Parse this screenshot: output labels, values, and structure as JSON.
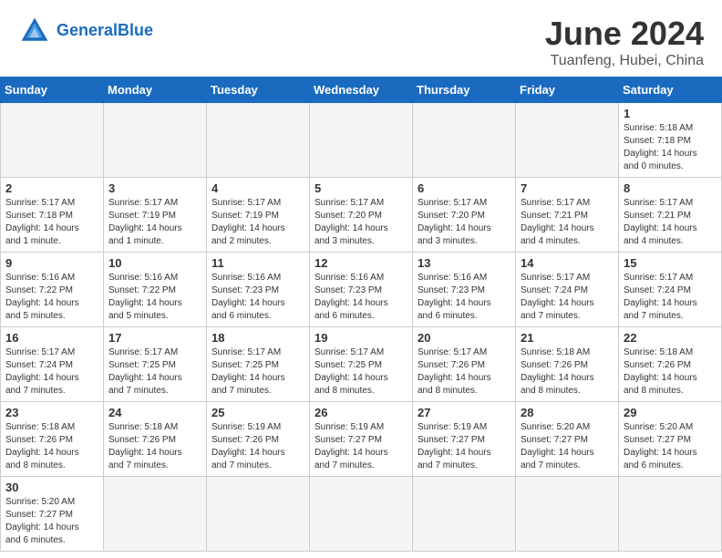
{
  "header": {
    "logo_general": "General",
    "logo_blue": "Blue",
    "title": "June 2024",
    "subtitle": "Tuanfeng, Hubei, China"
  },
  "weekdays": [
    "Sunday",
    "Monday",
    "Tuesday",
    "Wednesday",
    "Thursday",
    "Friday",
    "Saturday"
  ],
  "weeks": [
    [
      {
        "day": "",
        "info": ""
      },
      {
        "day": "",
        "info": ""
      },
      {
        "day": "",
        "info": ""
      },
      {
        "day": "",
        "info": ""
      },
      {
        "day": "",
        "info": ""
      },
      {
        "day": "",
        "info": ""
      },
      {
        "day": "1",
        "info": "Sunrise: 5:18 AM\nSunset: 7:18 PM\nDaylight: 14 hours\nand 0 minutes."
      }
    ],
    [
      {
        "day": "2",
        "info": "Sunrise: 5:17 AM\nSunset: 7:18 PM\nDaylight: 14 hours\nand 1 minute."
      },
      {
        "day": "3",
        "info": "Sunrise: 5:17 AM\nSunset: 7:19 PM\nDaylight: 14 hours\nand 1 minute."
      },
      {
        "day": "4",
        "info": "Sunrise: 5:17 AM\nSunset: 7:19 PM\nDaylight: 14 hours\nand 2 minutes."
      },
      {
        "day": "5",
        "info": "Sunrise: 5:17 AM\nSunset: 7:20 PM\nDaylight: 14 hours\nand 3 minutes."
      },
      {
        "day": "6",
        "info": "Sunrise: 5:17 AM\nSunset: 7:20 PM\nDaylight: 14 hours\nand 3 minutes."
      },
      {
        "day": "7",
        "info": "Sunrise: 5:17 AM\nSunset: 7:21 PM\nDaylight: 14 hours\nand 4 minutes."
      },
      {
        "day": "8",
        "info": "Sunrise: 5:17 AM\nSunset: 7:21 PM\nDaylight: 14 hours\nand 4 minutes."
      }
    ],
    [
      {
        "day": "9",
        "info": "Sunrise: 5:16 AM\nSunset: 7:22 PM\nDaylight: 14 hours\nand 5 minutes."
      },
      {
        "day": "10",
        "info": "Sunrise: 5:16 AM\nSunset: 7:22 PM\nDaylight: 14 hours\nand 5 minutes."
      },
      {
        "day": "11",
        "info": "Sunrise: 5:16 AM\nSunset: 7:23 PM\nDaylight: 14 hours\nand 6 minutes."
      },
      {
        "day": "12",
        "info": "Sunrise: 5:16 AM\nSunset: 7:23 PM\nDaylight: 14 hours\nand 6 minutes."
      },
      {
        "day": "13",
        "info": "Sunrise: 5:16 AM\nSunset: 7:23 PM\nDaylight: 14 hours\nand 6 minutes."
      },
      {
        "day": "14",
        "info": "Sunrise: 5:17 AM\nSunset: 7:24 PM\nDaylight: 14 hours\nand 7 minutes."
      },
      {
        "day": "15",
        "info": "Sunrise: 5:17 AM\nSunset: 7:24 PM\nDaylight: 14 hours\nand 7 minutes."
      }
    ],
    [
      {
        "day": "16",
        "info": "Sunrise: 5:17 AM\nSunset: 7:24 PM\nDaylight: 14 hours\nand 7 minutes."
      },
      {
        "day": "17",
        "info": "Sunrise: 5:17 AM\nSunset: 7:25 PM\nDaylight: 14 hours\nand 7 minutes."
      },
      {
        "day": "18",
        "info": "Sunrise: 5:17 AM\nSunset: 7:25 PM\nDaylight: 14 hours\nand 7 minutes."
      },
      {
        "day": "19",
        "info": "Sunrise: 5:17 AM\nSunset: 7:25 PM\nDaylight: 14 hours\nand 8 minutes."
      },
      {
        "day": "20",
        "info": "Sunrise: 5:17 AM\nSunset: 7:26 PM\nDaylight: 14 hours\nand 8 minutes."
      },
      {
        "day": "21",
        "info": "Sunrise: 5:18 AM\nSunset: 7:26 PM\nDaylight: 14 hours\nand 8 minutes."
      },
      {
        "day": "22",
        "info": "Sunrise: 5:18 AM\nSunset: 7:26 PM\nDaylight: 14 hours\nand 8 minutes."
      }
    ],
    [
      {
        "day": "23",
        "info": "Sunrise: 5:18 AM\nSunset: 7:26 PM\nDaylight: 14 hours\nand 8 minutes."
      },
      {
        "day": "24",
        "info": "Sunrise: 5:18 AM\nSunset: 7:26 PM\nDaylight: 14 hours\nand 7 minutes."
      },
      {
        "day": "25",
        "info": "Sunrise: 5:19 AM\nSunset: 7:26 PM\nDaylight: 14 hours\nand 7 minutes."
      },
      {
        "day": "26",
        "info": "Sunrise: 5:19 AM\nSunset: 7:27 PM\nDaylight: 14 hours\nand 7 minutes."
      },
      {
        "day": "27",
        "info": "Sunrise: 5:19 AM\nSunset: 7:27 PM\nDaylight: 14 hours\nand 7 minutes."
      },
      {
        "day": "28",
        "info": "Sunrise: 5:20 AM\nSunset: 7:27 PM\nDaylight: 14 hours\nand 7 minutes."
      },
      {
        "day": "29",
        "info": "Sunrise: 5:20 AM\nSunset: 7:27 PM\nDaylight: 14 hours\nand 6 minutes."
      }
    ],
    [
      {
        "day": "30",
        "info": "Sunrise: 5:20 AM\nSunset: 7:27 PM\nDaylight: 14 hours\nand 6 minutes."
      },
      {
        "day": "",
        "info": ""
      },
      {
        "day": "",
        "info": ""
      },
      {
        "day": "",
        "info": ""
      },
      {
        "day": "",
        "info": ""
      },
      {
        "day": "",
        "info": ""
      },
      {
        "day": "",
        "info": ""
      }
    ]
  ]
}
